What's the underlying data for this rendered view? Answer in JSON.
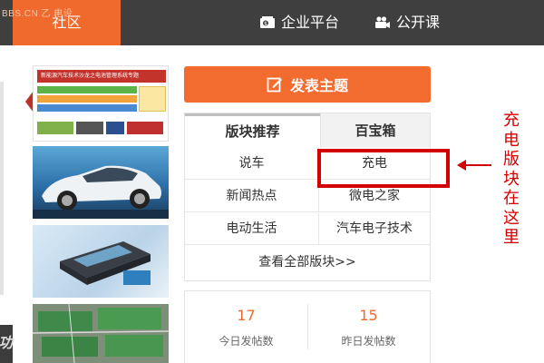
{
  "watermark": "BBS.CN 乙 电设",
  "nav": {
    "active_label": "社区",
    "enterprise_label": "企业平台",
    "course_label": "公开课",
    "enterprise_icon": "enterprise-icon",
    "course_icon": "video-camera-icon"
  },
  "thumbnails": {
    "first_banner": "新能源汽车技术沙龙之电池管理系统专题"
  },
  "post_button": {
    "label": "发表主题",
    "icon": "edit-icon"
  },
  "board": {
    "tabs": [
      "版块推荐",
      "百宝箱"
    ],
    "items": [
      [
        "说车",
        "充电"
      ],
      [
        "新闻热点",
        "微电之家"
      ],
      [
        "电动生活",
        "汽车电子技术"
      ]
    ],
    "view_all": "查看全部版块>>"
  },
  "annotation": {
    "text": "充电版块在这里",
    "color": "#d40000"
  },
  "stats": [
    {
      "value": "17",
      "label": "今日发帖数"
    },
    {
      "value": "15",
      "label": "昨日发帖数"
    }
  ],
  "colors": {
    "accent": "#f06a2d",
    "nav_bg": "#3f3f3f",
    "highlight": "#d40000"
  }
}
